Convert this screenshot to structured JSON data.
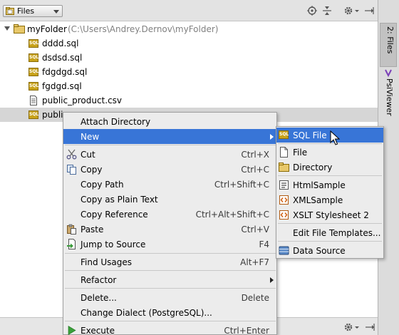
{
  "toolbar": {
    "view_label": "Files",
    "icons": [
      "target-icon",
      "collapse-all-icon",
      "settings-icon",
      "pin-icon"
    ]
  },
  "right_stripe": {
    "files_tab": "2: Files",
    "psiviewer_tab": "PsiViewer"
  },
  "tree": {
    "root": {
      "label": "myFolder",
      "path": "(C:\\Users\\Andrey.Dernov\\myFolder)"
    },
    "files": [
      {
        "label": "dddd.sql",
        "icon": "sql-file-icon"
      },
      {
        "label": "dsdsd.sql",
        "icon": "sql-file-icon"
      },
      {
        "label": "fdgdgd.sql",
        "icon": "sql-file-icon"
      },
      {
        "label": "fgdgd.sql",
        "icon": "sql-file-icon"
      },
      {
        "label": "public_product.csv",
        "icon": "text-file-icon"
      },
      {
        "label": "public",
        "icon": "sql-file-icon",
        "selected": true
      }
    ]
  },
  "context_menu": {
    "items": [
      {
        "label": "Attach Directory",
        "shortcut": ""
      },
      {
        "label": "New",
        "shortcut": "",
        "submenu": true,
        "highlighted": true
      },
      {
        "label": "Cut",
        "shortcut": "Ctrl+X",
        "icon": "scissors-icon"
      },
      {
        "label": "Copy",
        "shortcut": "Ctrl+C",
        "icon": "copy-icon"
      },
      {
        "label": "Copy Path",
        "shortcut": "Ctrl+Shift+C"
      },
      {
        "label": "Copy as Plain Text",
        "shortcut": ""
      },
      {
        "label": "Copy Reference",
        "shortcut": "Ctrl+Alt+Shift+C"
      },
      {
        "label": "Paste",
        "shortcut": "Ctrl+V",
        "icon": "paste-icon"
      },
      {
        "label": "Jump to Source",
        "shortcut": "F4",
        "icon": "jump-to-source-icon"
      },
      {
        "label": "Find Usages",
        "shortcut": "Alt+F7"
      },
      {
        "label": "Refactor",
        "shortcut": "",
        "submenu": true
      },
      {
        "label": "Delete...",
        "shortcut": "Delete"
      },
      {
        "label": "Change Dialect (PostgreSQL)...",
        "shortcut": ""
      },
      {
        "label": "Execute",
        "shortcut": "Ctrl+Enter",
        "icon": "run-icon"
      }
    ]
  },
  "submenu": {
    "items": [
      {
        "label": "SQL File",
        "icon": "sql-file-icon",
        "highlighted": true
      },
      {
        "label": "File",
        "icon": "file-icon"
      },
      {
        "label": "Directory",
        "icon": "folder-icon"
      },
      {
        "label": "HtmlSample",
        "icon": "html-icon"
      },
      {
        "label": "XMLSample",
        "icon": "xml-icon"
      },
      {
        "label": "XSLT Stylesheet 2",
        "icon": "xslt-icon"
      },
      {
        "label": "Edit File Templates...",
        "icon": ""
      },
      {
        "label": "Data Source",
        "icon": "database-icon"
      }
    ]
  },
  "colors": {
    "highlight": "#3875d7",
    "menu_bg": "#ececec",
    "sql_icon": "#c8a21a"
  }
}
